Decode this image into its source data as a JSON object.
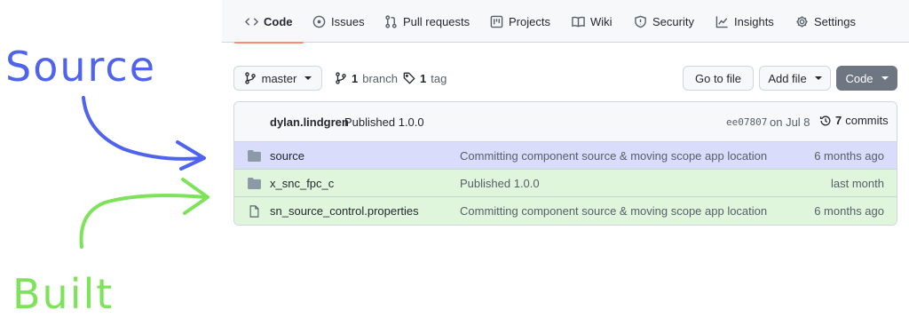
{
  "nav": {
    "tabs": [
      {
        "label": "Code",
        "icon": "code-icon"
      },
      {
        "label": "Issues",
        "icon": "issue-icon"
      },
      {
        "label": "Pull requests",
        "icon": "pull-request-icon"
      },
      {
        "label": "Projects",
        "icon": "projects-icon"
      },
      {
        "label": "Wiki",
        "icon": "wiki-book-icon"
      },
      {
        "label": "Security",
        "icon": "shield-icon"
      },
      {
        "label": "Insights",
        "icon": "graph-icon"
      },
      {
        "label": "Settings",
        "icon": "gear-icon"
      }
    ],
    "active_tab": "Code"
  },
  "toolbar": {
    "branch_selector": "master",
    "branch_count": "1",
    "branch_label": "branch",
    "tag_count": "1",
    "tag_label": "tag",
    "go_to_file": "Go to file",
    "add_file": "Add file",
    "code_button": "Code"
  },
  "latest_commit": {
    "author": "dylan.lindgren",
    "message": "Published 1.0.0",
    "sha": "ee07807",
    "date": "on Jul 8",
    "commit_count": "7",
    "commit_label": "commits"
  },
  "files": [
    {
      "type": "folder",
      "name": "source",
      "message": "Committing component source & moving scope app location",
      "age": "6 months ago",
      "highlight": "#d9dcfa"
    },
    {
      "type": "folder",
      "name": "x_snc_fpc_c",
      "message": "Published 1.0.0",
      "age": "last month",
      "highlight": "#dff6dc"
    },
    {
      "type": "file",
      "name": "sn_source_control.properties",
      "message": "Committing component source & moving scope app location",
      "age": "6 months ago",
      "highlight": "#dff6dc"
    }
  ],
  "annotations": {
    "source_label": "Source",
    "source_color": "#4f63ef",
    "built_label": "Built",
    "built_color": "#7ee35a"
  },
  "colors": {
    "folder_icon": "#8c99a6",
    "tab_underline": "#fd8c73",
    "code_button_bg": "#6e7781"
  }
}
